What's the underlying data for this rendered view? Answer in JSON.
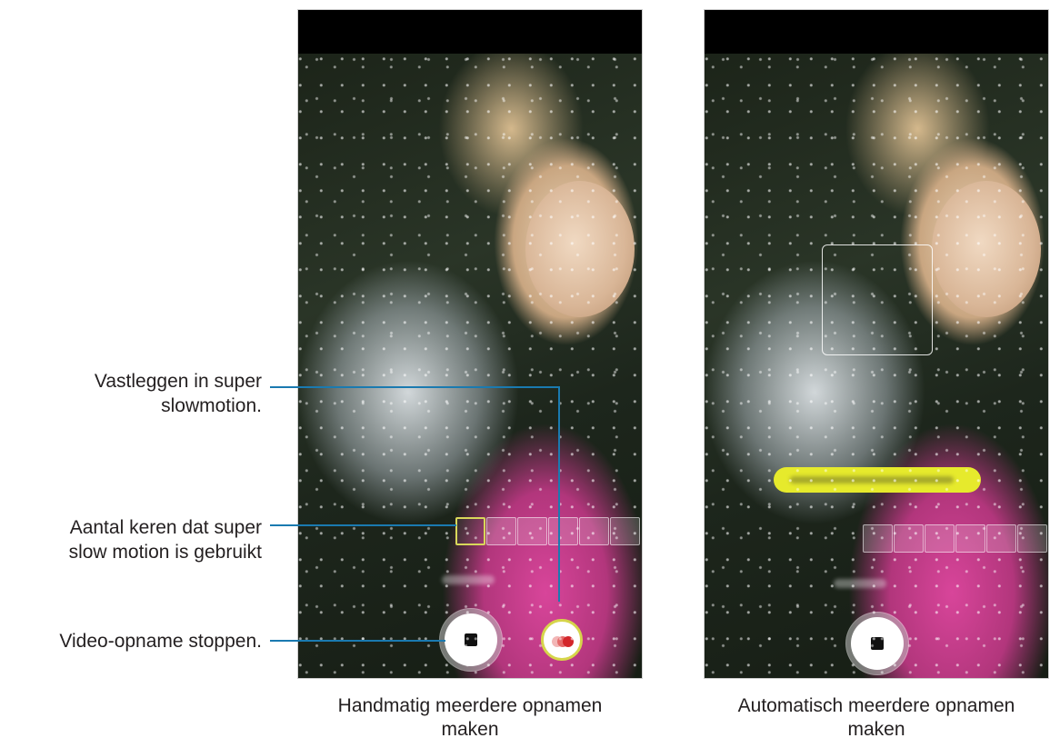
{
  "callouts": {
    "capture": "Vastleggen in super\nslowmotion.",
    "count": "Aantal keren dat super\nslow motion is gebruikt",
    "stop": "Video-opname stoppen."
  },
  "captions": {
    "left": "Handmatig meerdere opnamen\nmaken",
    "right": "Automatisch meerdere opnamen\nmaken"
  },
  "left_screen": {
    "frame_count_total": 6,
    "frames_used": 1,
    "stop_icon": "stop-icon",
    "capture_icon": "super-slow-motion-dots-icon"
  },
  "right_screen": {
    "frame_count_total": 6,
    "frames_used": 0,
    "stop_icon": "stop-icon",
    "banner_color": "#e6ea2c"
  },
  "colors": {
    "callout_line": "#1a7ab0",
    "accent_yellow": "#d6d54a"
  }
}
